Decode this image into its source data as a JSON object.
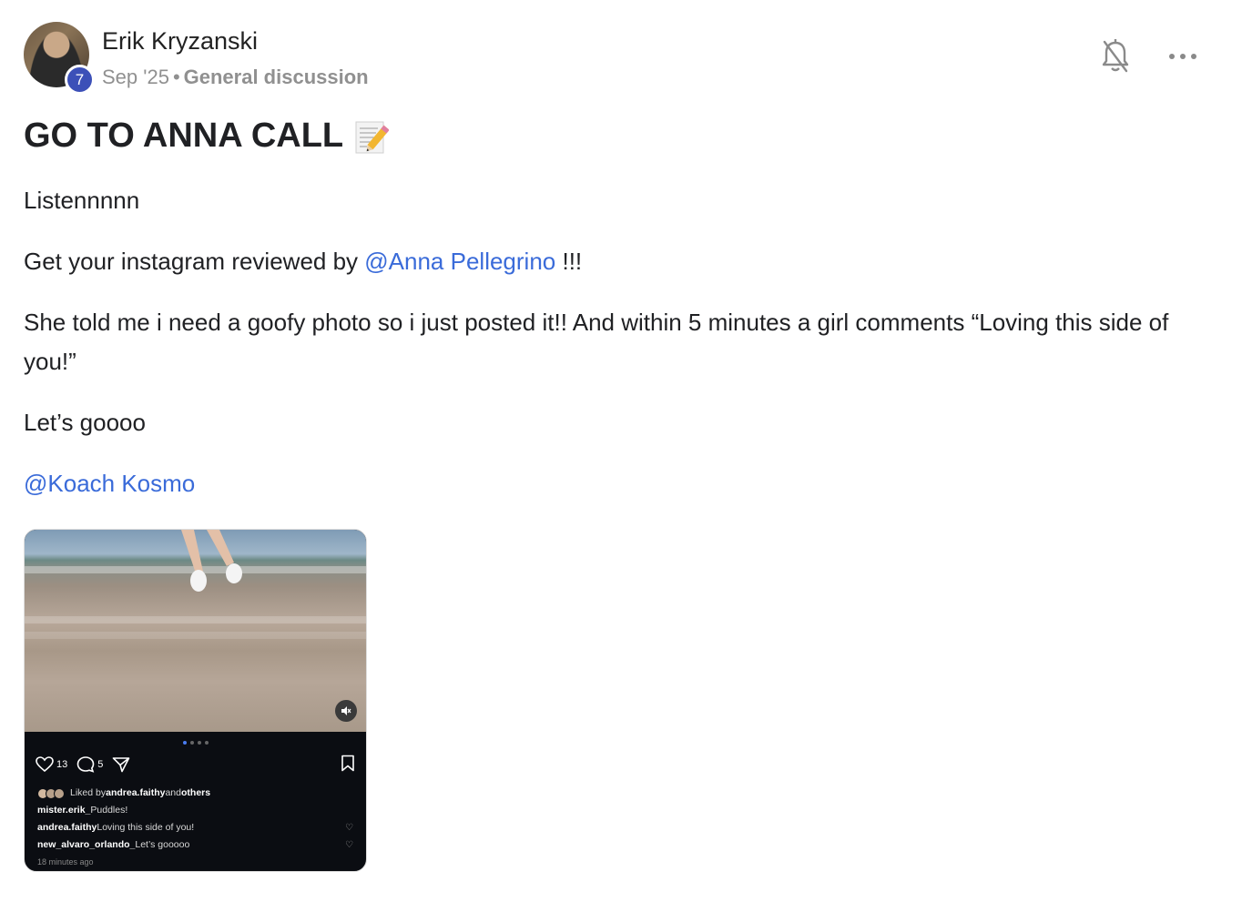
{
  "post": {
    "author": "Erik Kryzanski",
    "level": "7",
    "date": "Sep '25",
    "separator": "•",
    "category": "General discussion",
    "title": "GO TO ANNA CALL",
    "title_emoji_icon": "memo-icon",
    "body": {
      "p1": "Listennnnn",
      "p2_before": "Get your instagram reviewed by ",
      "p2_mention": "@Anna Pellegrino",
      "p2_after": " !!!",
      "p3": "She told me i need a goofy photo so i just posted it!! And within 5 minutes a girl comments “Loving this side of you!”",
      "p4": "Let’s goooo",
      "p5_mention": "@Koach Kosmo"
    },
    "colors": {
      "mention": "#3a6bd9",
      "level_badge": "#3c50b8"
    }
  },
  "instagram": {
    "likes": "13",
    "comments": "5",
    "liked_by_prefix": "Liked by ",
    "liked_by_user": "andrea.faithy",
    "liked_by_and": " and ",
    "liked_by_others": "others",
    "caption_user": "mister.erik_",
    "caption_text": " Puddles!",
    "comment1_user": "andrea.faithy",
    "comment1_text": " Loving this side of you!",
    "comment2_user": "new_alvaro_orlando_",
    "comment2_text": " Let’s gooooo",
    "time": "18 minutes ago"
  }
}
